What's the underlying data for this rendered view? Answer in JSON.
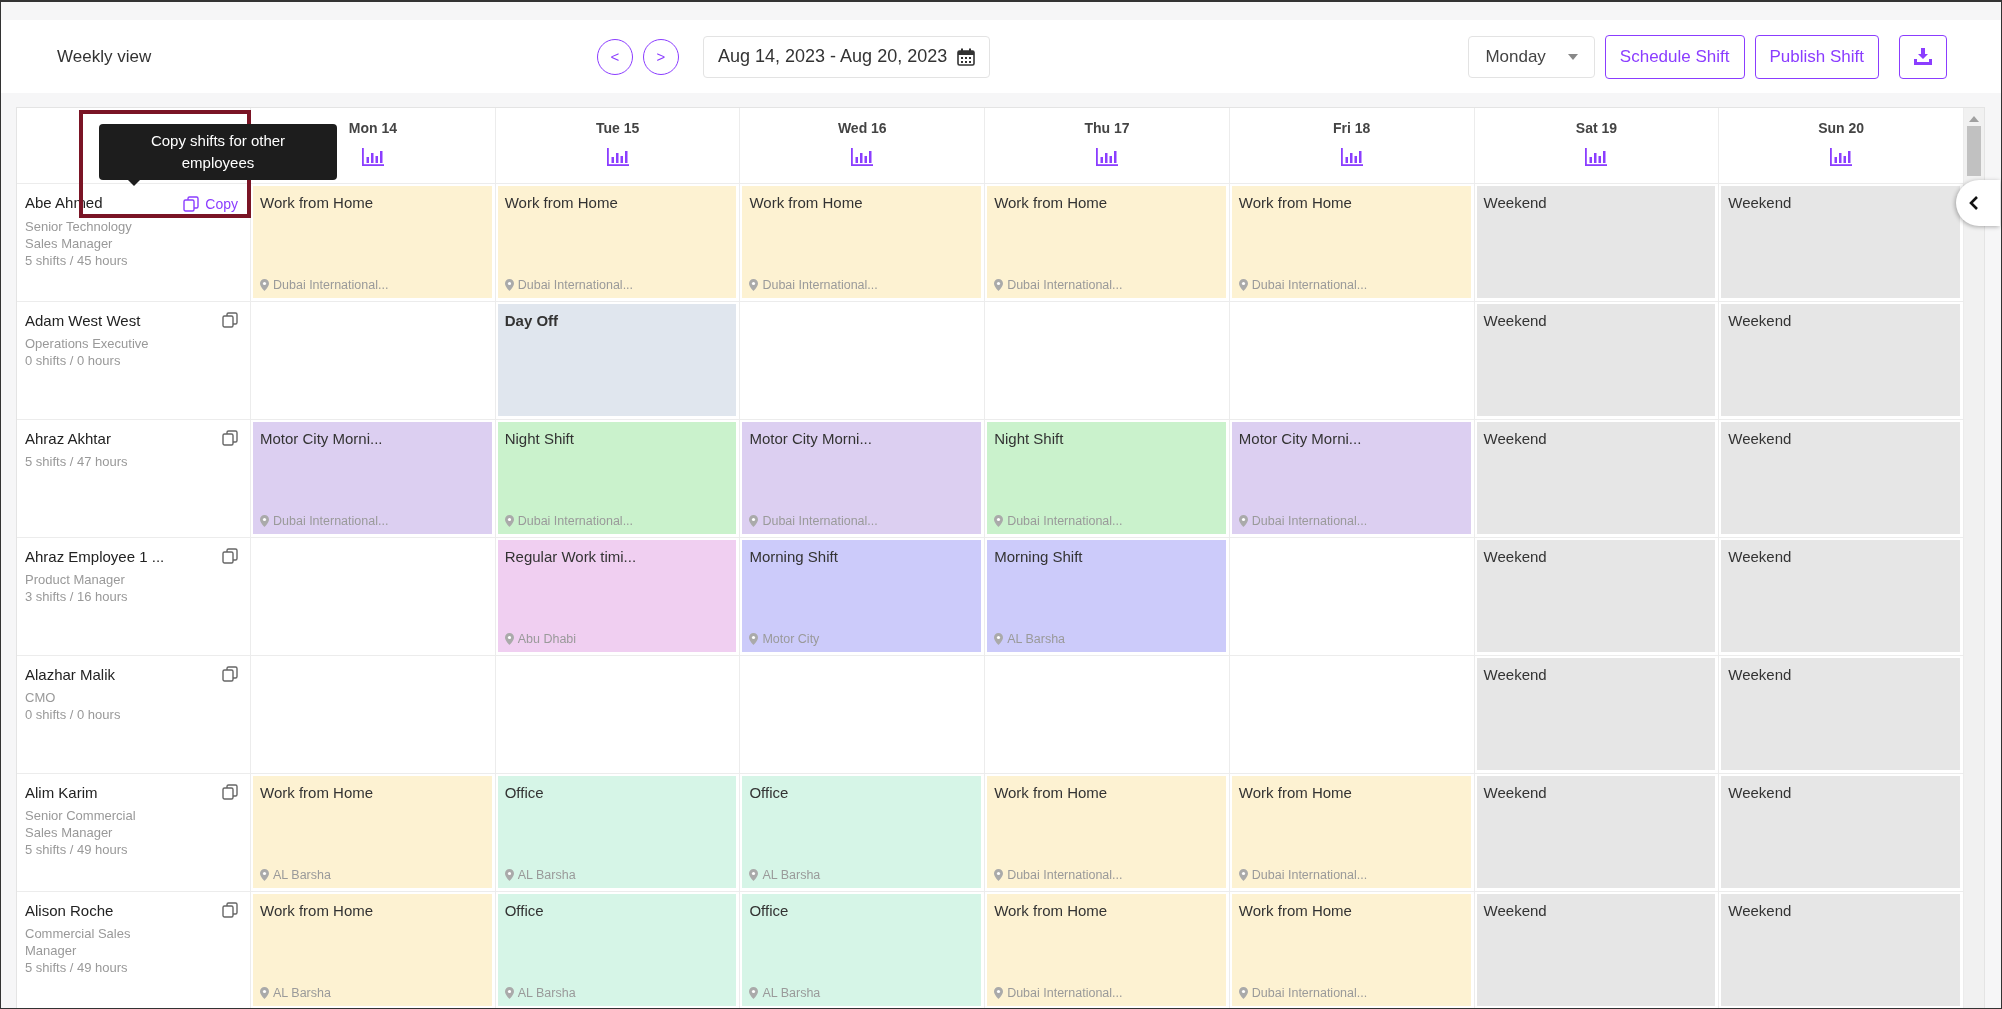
{
  "toolbar": {
    "title": "Weekly view",
    "prev": "<",
    "next": ">",
    "date_range": "Aug 14, 2023 - Aug 20, 2023",
    "start_day": "Monday",
    "buttons": [
      "Schedule Shift",
      "Publish Shift"
    ]
  },
  "days": [
    "Mon 14",
    "Tue 15",
    "Wed 16",
    "Thu 17",
    "Fri 18",
    "Sat 19",
    "Sun 20"
  ],
  "tooltip": {
    "text": "Copy shifts for other employees"
  },
  "highlight_frame": {
    "shown": true
  },
  "rows": [
    {
      "name": "Abe Ahmed",
      "title": "Senior Technology Sales Manager",
      "summary": "5 shifts / 45 hours",
      "copy_label": "Copy",
      "cells": [
        {
          "kind": "shift",
          "label": "Work from Home",
          "location": "Dubai International...",
          "color": "#fdf2d2"
        },
        {
          "kind": "shift",
          "label": "Work from Home",
          "location": "Dubai International...",
          "color": "#fdf2d2"
        },
        {
          "kind": "shift",
          "label": "Work from Home",
          "location": "Dubai International...",
          "color": "#fdf2d2"
        },
        {
          "kind": "shift",
          "label": "Work from Home",
          "location": "Dubai International...",
          "color": "#fdf2d2"
        },
        {
          "kind": "shift",
          "label": "Work from Home",
          "location": "Dubai International...",
          "color": "#fdf2d2"
        },
        {
          "kind": "weekend",
          "label": "Weekend",
          "color": "#e6e6e6"
        },
        {
          "kind": "weekend",
          "label": "Weekend",
          "color": "#e6e6e6"
        }
      ]
    },
    {
      "name": "Adam West West",
      "title": "Operations Executive",
      "summary": "0 shifts / 0 hours",
      "cells": [
        {
          "kind": "empty"
        },
        {
          "kind": "dayoff",
          "label": "Day Off",
          "color": "#e0e6ee"
        },
        {
          "kind": "empty"
        },
        {
          "kind": "empty"
        },
        {
          "kind": "empty"
        },
        {
          "kind": "weekend",
          "label": "Weekend",
          "color": "#e6e6e6"
        },
        {
          "kind": "weekend",
          "label": "Weekend",
          "color": "#e6e6e6"
        }
      ]
    },
    {
      "name": "Ahraz Akhtar",
      "summary": "5 shifts / 47 hours",
      "cells": [
        {
          "kind": "shift",
          "label": "Motor City Morni...",
          "location": "Dubai International...",
          "color": "#dccff1"
        },
        {
          "kind": "shift",
          "label": "Night Shift",
          "location": "Dubai International...",
          "color": "#caf2cc"
        },
        {
          "kind": "shift",
          "label": "Motor City Morni...",
          "location": "Dubai International...",
          "color": "#dccff1"
        },
        {
          "kind": "shift",
          "label": "Night Shift",
          "location": "Dubai International...",
          "color": "#caf2cc"
        },
        {
          "kind": "shift",
          "label": "Motor City Morni...",
          "location": "Dubai International...",
          "color": "#dccff1"
        },
        {
          "kind": "weekend",
          "label": "Weekend",
          "color": "#e6e6e6"
        },
        {
          "kind": "weekend",
          "label": "Weekend",
          "color": "#e6e6e6"
        }
      ]
    },
    {
      "name": "Ahraz Employee 1 ...",
      "title": "Product Manager",
      "summary": "3 shifts / 16 hours",
      "cells": [
        {
          "kind": "empty"
        },
        {
          "kind": "shift",
          "label": "Regular Work timi...",
          "location": "Abu Dhabi",
          "color": "#f0cff1"
        },
        {
          "kind": "shift",
          "label": "Morning Shift",
          "location": "Motor City",
          "color": "#cccbfa"
        },
        {
          "kind": "shift",
          "label": "Morning Shift",
          "location": "AL Barsha",
          "color": "#cccbfa"
        },
        {
          "kind": "empty"
        },
        {
          "kind": "weekend",
          "label": "Weekend",
          "color": "#e6e6e6"
        },
        {
          "kind": "weekend",
          "label": "Weekend",
          "color": "#e6e6e6"
        }
      ]
    },
    {
      "name": "Alazhar Malik",
      "title": "CMO",
      "summary": "0 shifts / 0 hours",
      "cells": [
        {
          "kind": "empty"
        },
        {
          "kind": "empty"
        },
        {
          "kind": "empty"
        },
        {
          "kind": "empty"
        },
        {
          "kind": "empty"
        },
        {
          "kind": "weekend",
          "label": "Weekend",
          "color": "#e6e6e6"
        },
        {
          "kind": "weekend",
          "label": "Weekend",
          "color": "#e6e6e6"
        }
      ]
    },
    {
      "name": "Alim Karim",
      "title": "Senior Commercial Sales Manager",
      "summary": "5 shifts / 49 hours",
      "cells": [
        {
          "kind": "shift",
          "label": "Work from Home",
          "location": "AL Barsha",
          "color": "#fdf2d2"
        },
        {
          "kind": "shift",
          "label": "Office",
          "location": "AL Barsha",
          "color": "#d6f5e7"
        },
        {
          "kind": "shift",
          "label": "Office",
          "location": "AL Barsha",
          "color": "#d6f5e7"
        },
        {
          "kind": "shift",
          "label": "Work from Home",
          "location": "Dubai International...",
          "color": "#fdf2d2"
        },
        {
          "kind": "shift",
          "label": "Work from Home",
          "location": "Dubai International...",
          "color": "#fdf2d2"
        },
        {
          "kind": "weekend",
          "label": "Weekend",
          "color": "#e6e6e6"
        },
        {
          "kind": "weekend",
          "label": "Weekend",
          "color": "#e6e6e6"
        }
      ]
    },
    {
      "name": "Alison Roche",
      "title": "Commercial Sales Manager",
      "summary": "5 shifts / 49 hours",
      "cells": [
        {
          "kind": "shift",
          "label": "Work from Home",
          "location": "AL Barsha",
          "color": "#fdf2d2"
        },
        {
          "kind": "shift",
          "label": "Office",
          "location": "AL Barsha",
          "color": "#d6f5e7"
        },
        {
          "kind": "shift",
          "label": "Office",
          "location": "AL Barsha",
          "color": "#d6f5e7"
        },
        {
          "kind": "shift",
          "label": "Work from Home",
          "location": "Dubai International...",
          "color": "#fdf2d2"
        },
        {
          "kind": "shift",
          "label": "Work from Home",
          "location": "Dubai International...",
          "color": "#fdf2d2"
        },
        {
          "kind": "weekend",
          "label": "Weekend",
          "color": "#e6e6e6"
        },
        {
          "kind": "weekend",
          "label": "Weekend",
          "color": "#e6e6e6"
        }
      ]
    }
  ]
}
